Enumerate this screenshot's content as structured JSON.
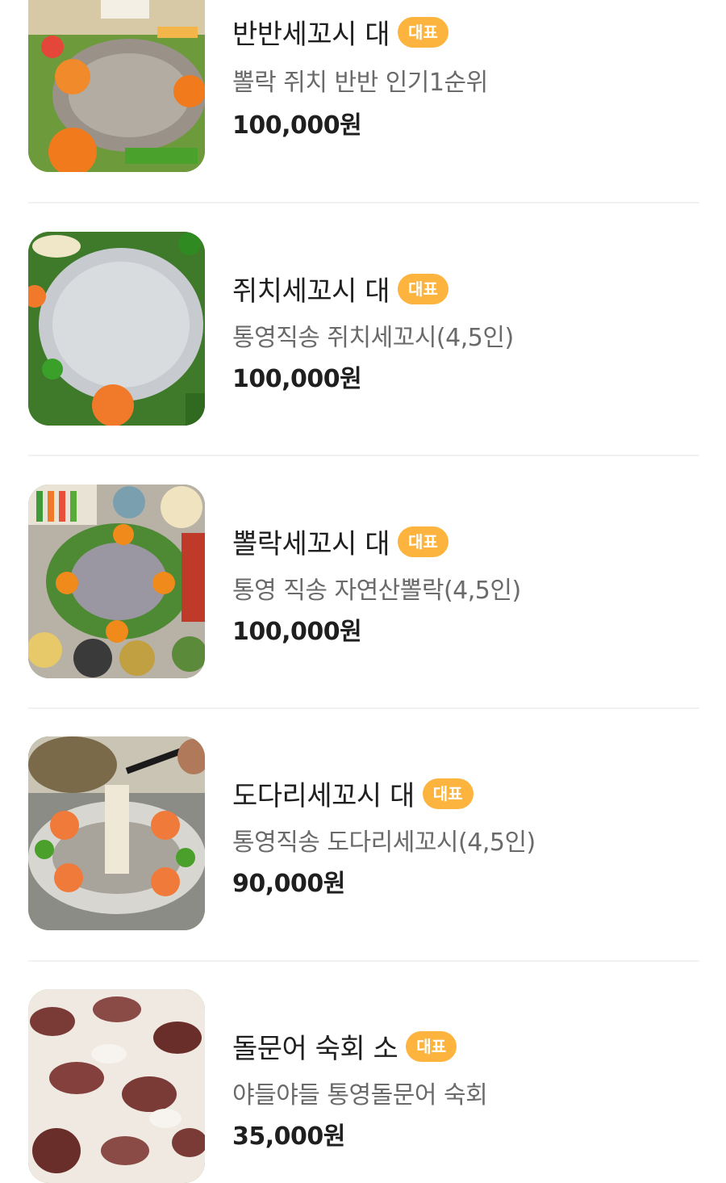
{
  "menu": {
    "items": [
      {
        "name": "반반세꼬시 대",
        "badge": "대표",
        "description": "뽈락 쥐치 반반 인기1순위",
        "price": "100,000원",
        "image": "banban-sashimi-photo"
      },
      {
        "name": "쥐치세꼬시 대",
        "badge": "대표",
        "description": "통영직송 쥐치세꼬시(4,5인)",
        "price": "100,000원",
        "image": "jwichi-sashimi-photo"
      },
      {
        "name": "뽈락세꼬시 대",
        "badge": "대표",
        "description": "통영 직송 자연산뽈락(4,5인)",
        "price": "100,000원",
        "image": "bollak-sashimi-photo"
      },
      {
        "name": "도다리세꼬시 대",
        "badge": "대표",
        "description": "통영직송 도다리세꼬시(4,5인)",
        "price": "90,000원",
        "image": "dodari-sashimi-photo"
      },
      {
        "name": "돌문어 숙회 소",
        "badge": "대표",
        "description": "야들야들 통영돌문어 숙회",
        "price": "35,000원",
        "image": "octopus-sukhoe-photo"
      }
    ]
  },
  "colors": {
    "badge": "#fdb43f",
    "name": "#1f1f1f",
    "description": "#6a6a6a",
    "divider": "#f1f1f1"
  }
}
